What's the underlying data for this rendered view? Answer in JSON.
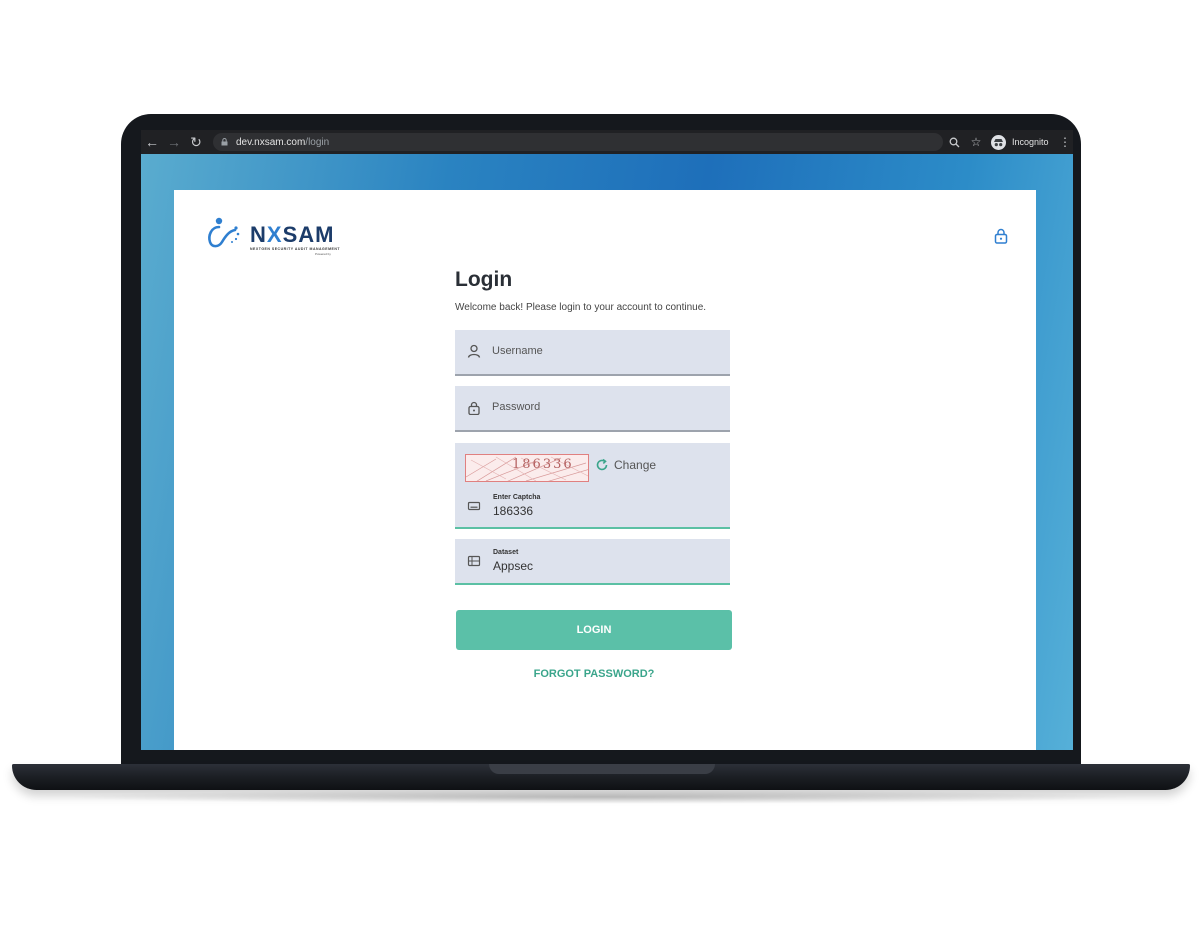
{
  "browser": {
    "url_host": "dev.nxsam.com",
    "url_path": "/login",
    "profile_label": "Incognito"
  },
  "logo": {
    "name_prefix": "N",
    "name_x": "X",
    "name_suffix": "SAM",
    "tagline": "NEXTGEN SECURITY AUDIT MANAGEMENT",
    "powered_by": "Powered by"
  },
  "login": {
    "title": "Login",
    "subtitle": "Welcome back! Please login to your account to continue.",
    "username_placeholder": "Username",
    "password_placeholder": "Password",
    "captcha_image_text": "186336",
    "captcha_change_label": "Change",
    "captcha_label": "Enter Captcha",
    "captcha_value": "186336",
    "dataset_label": "Dataset",
    "dataset_value": "Appsec",
    "login_button": "LOGIN",
    "forgot_password": "FORGOT PASSWORD?"
  },
  "colors": {
    "accent": "#5bc0a8",
    "link": "#3aa58b",
    "field_bg": "#dde2ed",
    "brand_dark": "#1c3c6a",
    "brand_blue": "#2f7fd0"
  }
}
